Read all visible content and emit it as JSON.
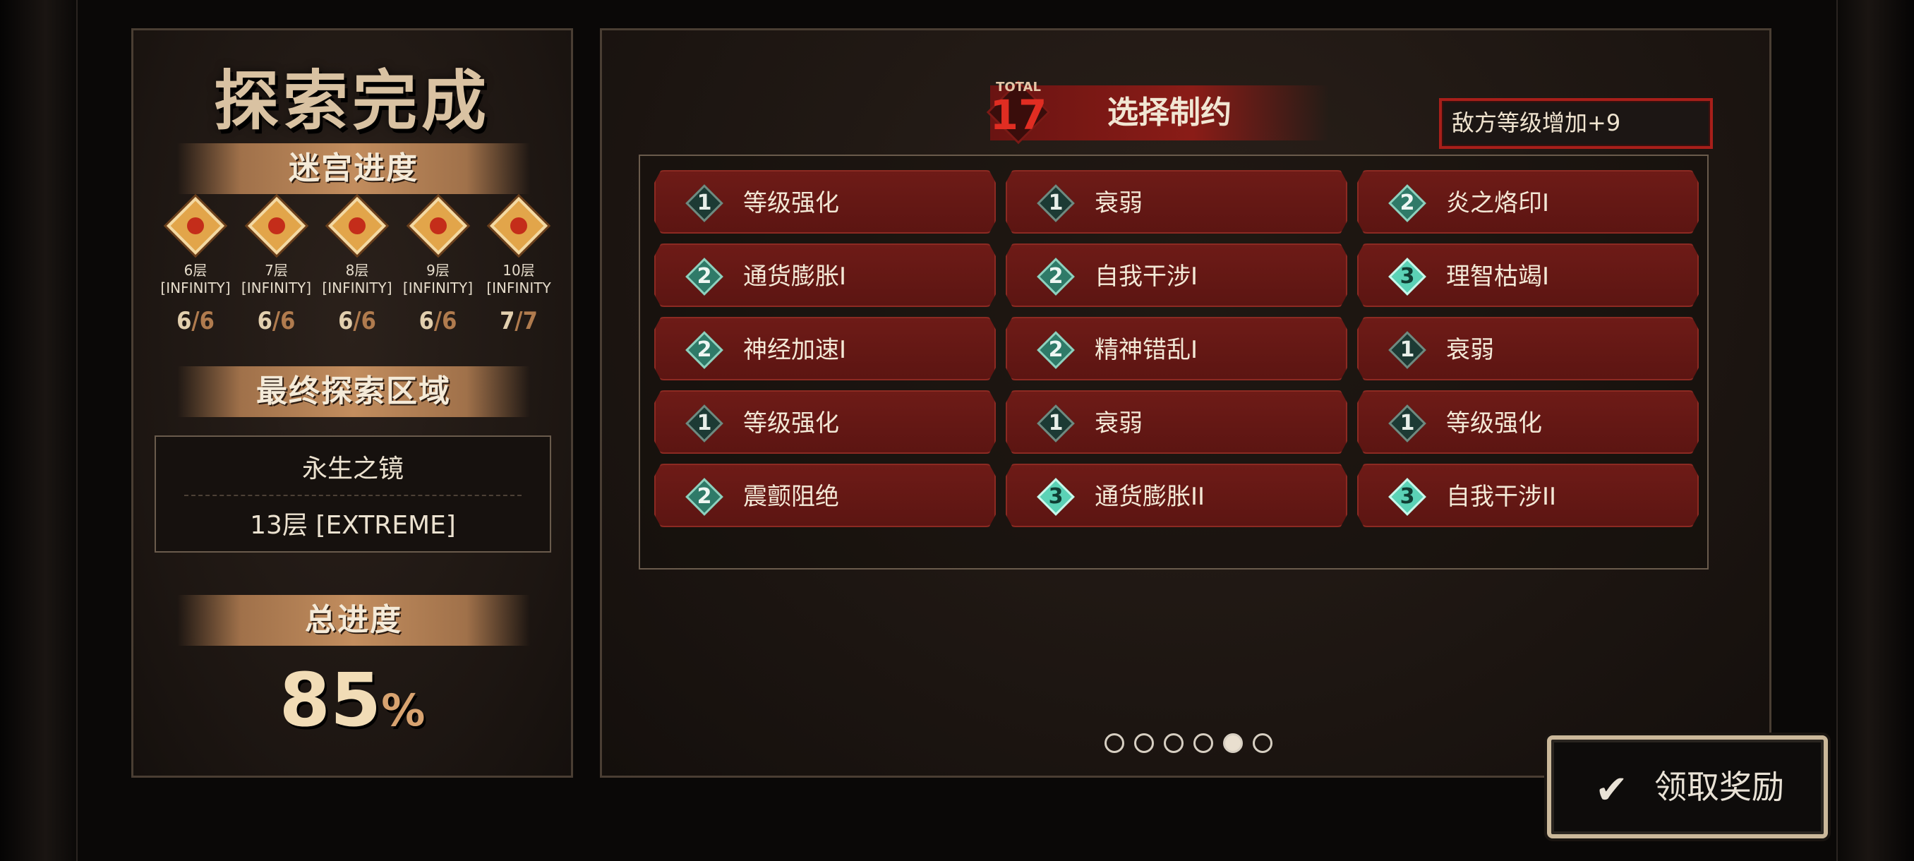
{
  "left": {
    "title": "探索完成",
    "maze_progress_label": "迷宫进度",
    "floors": [
      {
        "label_line1": "6层",
        "label_line2": "[INFINITY]",
        "cleared": "6",
        "total": "6"
      },
      {
        "label_line1": "7层",
        "label_line2": "[INFINITY]",
        "cleared": "6",
        "total": "6"
      },
      {
        "label_line1": "8层",
        "label_line2": "[INFINITY]",
        "cleared": "6",
        "total": "6"
      },
      {
        "label_line1": "9层",
        "label_line2": "[INFINITY]",
        "cleared": "6",
        "total": "6"
      },
      {
        "label_line1": "10层",
        "label_line2": "[INFINITY",
        "cleared": "7",
        "total": "7"
      }
    ],
    "final_area_label": "最终探索区域",
    "final_area_name": "永生之镜",
    "final_area_floor": "13层 [EXTREME]",
    "total_progress_label": "总进度",
    "total_progress_value": "85",
    "total_progress_unit": "%"
  },
  "right": {
    "total_label": "TOTAL",
    "total_value": "17",
    "select_title": "选择制约",
    "enemy_level_text": "敌方等级增加+9",
    "constraints": [
      {
        "level": "1",
        "label": "等级强化"
      },
      {
        "level": "1",
        "label": "衰弱"
      },
      {
        "level": "2",
        "label": "炎之烙印I"
      },
      {
        "level": "2",
        "label": "通货膨胀I"
      },
      {
        "level": "2",
        "label": "自我干涉I"
      },
      {
        "level": "3",
        "label": "理智枯竭I"
      },
      {
        "level": "2",
        "label": "神经加速I"
      },
      {
        "level": "2",
        "label": "精神错乱I"
      },
      {
        "level": "1",
        "label": "衰弱"
      },
      {
        "level": "1",
        "label": "等级强化"
      },
      {
        "level": "1",
        "label": "衰弱"
      },
      {
        "level": "1",
        "label": "等级强化"
      },
      {
        "level": "2",
        "label": "震颤阻绝"
      },
      {
        "level": "3",
        "label": "通货膨胀II"
      },
      {
        "level": "3",
        "label": "自我干涉II"
      }
    ],
    "page_count": 6,
    "active_page": 5
  },
  "claim_button": {
    "icon": "checkmark-icon",
    "label": "领取奖励"
  }
}
